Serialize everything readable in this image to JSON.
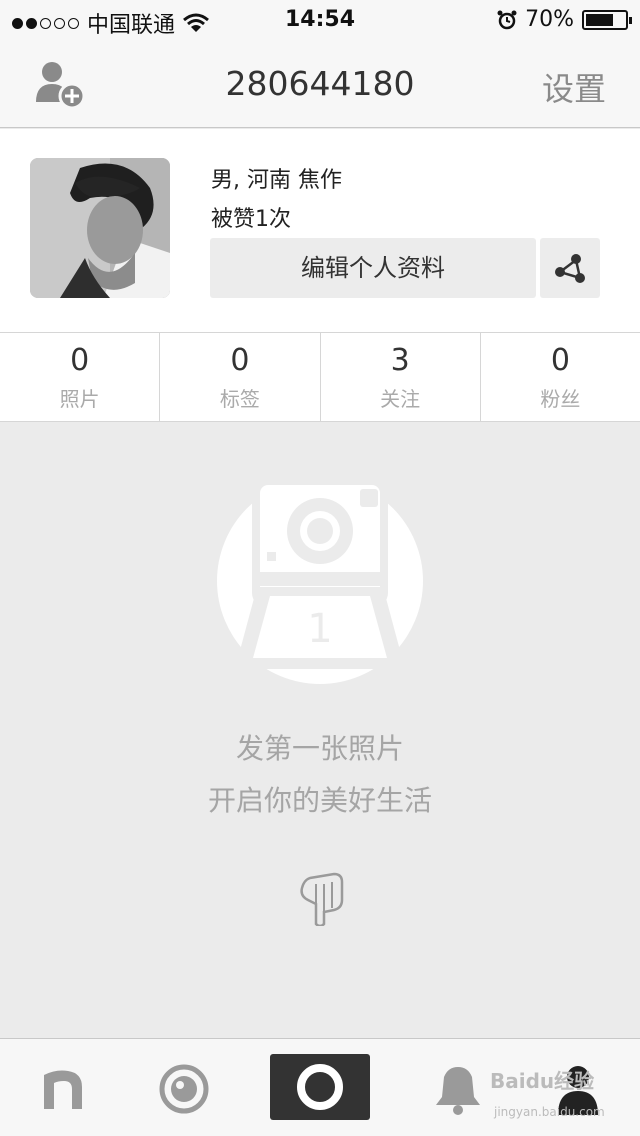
{
  "status_bar": {
    "carrier": "中国联通",
    "time": "14:54",
    "battery": "70%",
    "battery_level": 0.7
  },
  "nav": {
    "title": "280644180",
    "settings_label": "设置"
  },
  "profile": {
    "gender_location": "男, 河南 焦作",
    "likes": "被赞1次",
    "edit_label": "编辑个人资料"
  },
  "stats": [
    {
      "value": "0",
      "label": "照片"
    },
    {
      "value": "0",
      "label": "标签"
    },
    {
      "value": "3",
      "label": "关注"
    },
    {
      "value": "0",
      "label": "粉丝"
    }
  ],
  "empty_state": {
    "line1": "发第一张照片",
    "line2": "开启你的美好生活",
    "photo_number": "1"
  },
  "tab_bar": {
    "watermark": "Baidu经验",
    "watermark_sub": "jingyan.baidu.com"
  },
  "colors": {
    "accent_dark": "#333333",
    "background": "#ebebeb"
  }
}
